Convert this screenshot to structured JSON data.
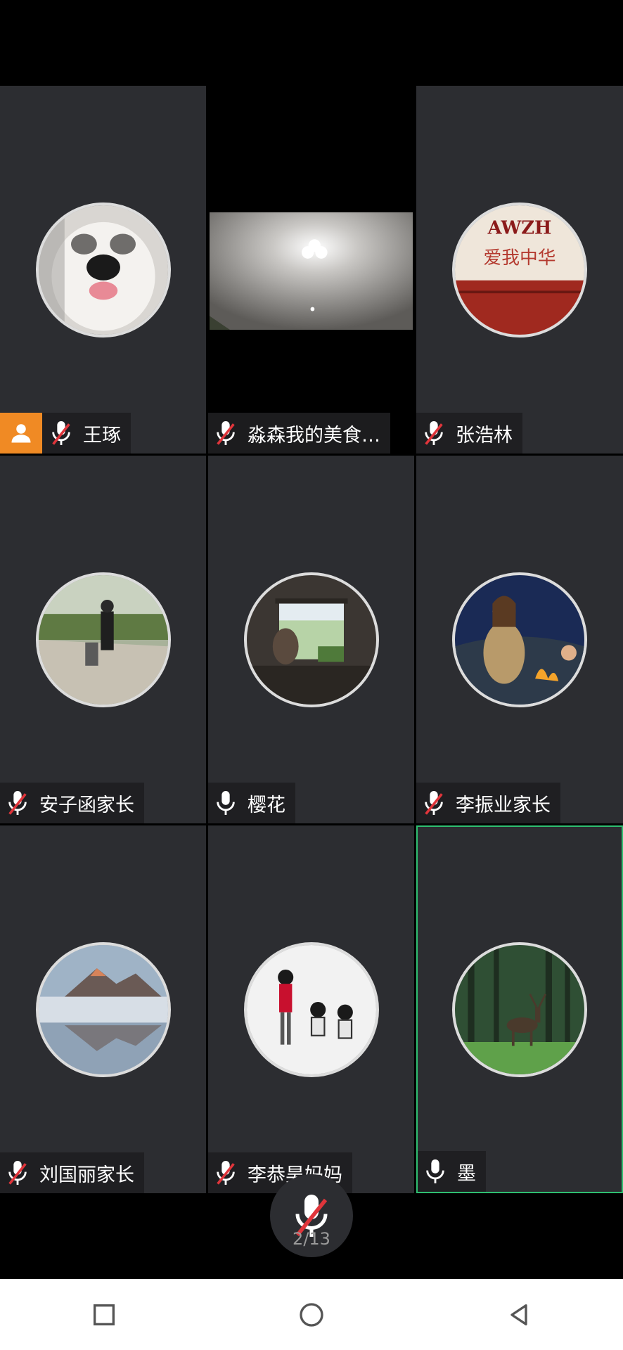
{
  "participants": [
    {
      "name": "王琢",
      "mic": "muted",
      "host": true,
      "avatar_icon": "dog-avatar"
    },
    {
      "name": "淼森我的美食…",
      "mic": "muted",
      "video": true,
      "avatar_icon": "ceiling-light-video"
    },
    {
      "name": "张浩林",
      "mic": "muted",
      "avatar_icon": "awzh-sign-avatar",
      "avatar_text_1": "AWZH",
      "avatar_text_2": "爱我中华"
    },
    {
      "name": "安子函家长",
      "mic": "muted",
      "avatar_icon": "outdoor-person-avatar"
    },
    {
      "name": "樱花",
      "mic": "on",
      "avatar_icon": "window-reading-avatar"
    },
    {
      "name": "李振业家长",
      "mic": "muted",
      "avatar_icon": "campfire-anime-avatar"
    },
    {
      "name": "刘国丽家长",
      "mic": "muted",
      "avatar_icon": "mountain-lake-avatar"
    },
    {
      "name": "李恭昊妈妈",
      "mic": "muted",
      "avatar_icon": "family-walking-avatar"
    },
    {
      "name": "墨",
      "mic": "on",
      "active": true,
      "avatar_icon": "deer-forest-avatar"
    }
  ],
  "controls": {
    "mute_button_icon": "mic-muted-icon",
    "page_indicator": "2/13"
  },
  "nav": {
    "recent_icon": "square-icon",
    "home_icon": "circle-icon",
    "back_icon": "triangle-back-icon"
  },
  "colors": {
    "tile_bg": "#2c2d31",
    "host_badge": "#f08a24",
    "active_border": "#2fbf71",
    "muted_slash": "#e0353b"
  }
}
